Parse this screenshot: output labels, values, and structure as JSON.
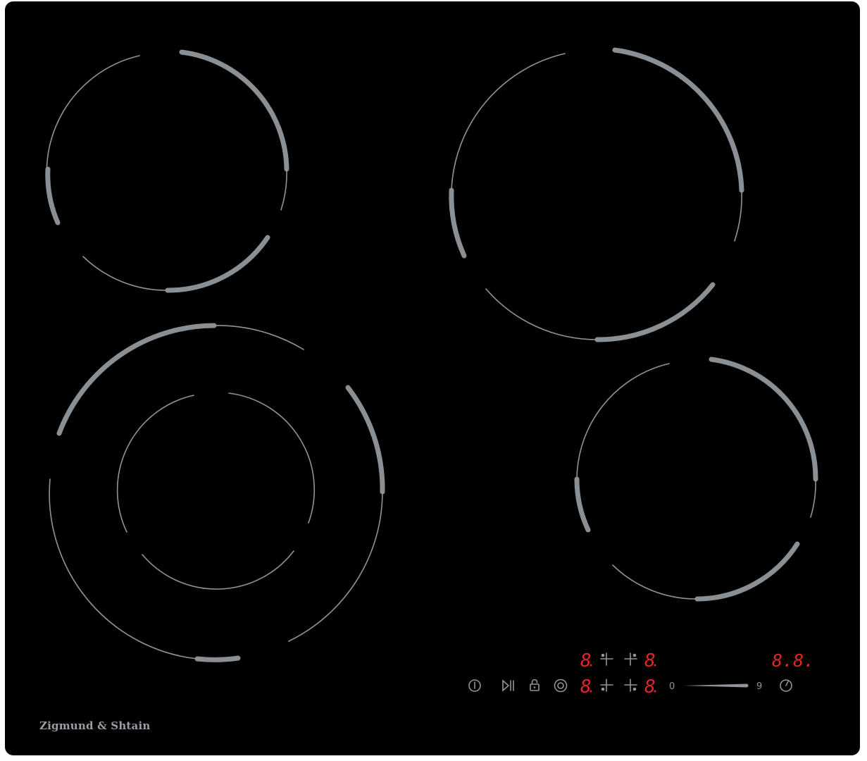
{
  "brand": {
    "name": "Zigmund & Shtain"
  },
  "colors": {
    "glass": "#000000",
    "ring": "#8e9498",
    "display": "#e0262a",
    "touch_control": "#8f959a"
  },
  "burners": [
    {
      "id": "rear-left",
      "type": "single"
    },
    {
      "id": "rear-right",
      "type": "single"
    },
    {
      "id": "front-left",
      "type": "dual"
    },
    {
      "id": "front-right",
      "type": "single"
    }
  ],
  "controls": {
    "power_icon": "power-icon",
    "pause_icon": "play-pause-icon",
    "lock_icon": "lock-icon",
    "dual_zone_icon": "dual-zone-icon",
    "timer_icon": "timer-icon",
    "slider": {
      "min_label": "0",
      "max_label": "9"
    }
  },
  "displays": {
    "rear_left": "8",
    "rear_right": "8",
    "front_left": "8",
    "front_right": "8",
    "timer": "8.8."
  }
}
